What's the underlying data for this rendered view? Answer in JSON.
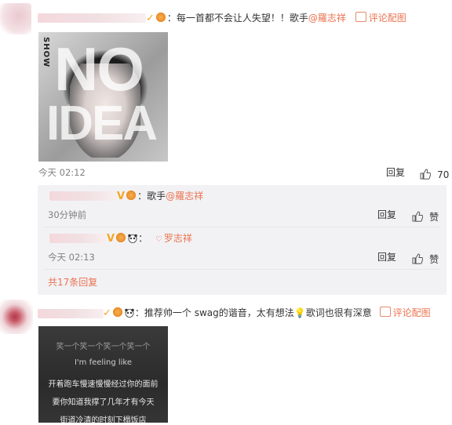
{
  "comments": [
    {
      "text_prefix": "：每一首都不会让人失望！！歌手",
      "mention": "@羅志祥",
      "image_action": "评论配图",
      "album": {
        "side_text": "SHOW",
        "big_text": "NO\nIDEA"
      },
      "time": "今天 02:12",
      "reply_label": "回复",
      "like_count": "70"
    },
    {
      "text_prefix": "：推荐帅一个 swag的谐音，太有想法",
      "text_suffix": "歌词也很有深意",
      "image_action": "评论配图",
      "lyrics": [
        "笑一个笑一个笑一个笑一个",
        "I'm feeling like",
        "开着跑车慢速慢慢经过你的面前",
        "要你知道我撑了几年才有今天",
        "街道冷清的时刻下榻饭店"
      ]
    }
  ],
  "replies": [
    {
      "text_prefix": "：歌手",
      "mention": "@羅志祥",
      "time": "30分钟前",
      "reply_label": "回复",
      "like_label": "赞"
    },
    {
      "text_prefix": "：",
      "mention": "罗志祥",
      "time": "今天 02:13",
      "reply_label": "回复",
      "like_label": "赞"
    }
  ],
  "more_replies": "共17条回复",
  "colors": {
    "accent": "#eb7350",
    "badge": "#f5a623",
    "panel": "#f2f2f5"
  },
  "icons": [
    "v-badge-icon",
    "fan-badge-icon",
    "panda-emoji-icon",
    "image-icon",
    "thumbs-up-icon",
    "lightbulb-emoji-icon",
    "heart-link-icon"
  ]
}
